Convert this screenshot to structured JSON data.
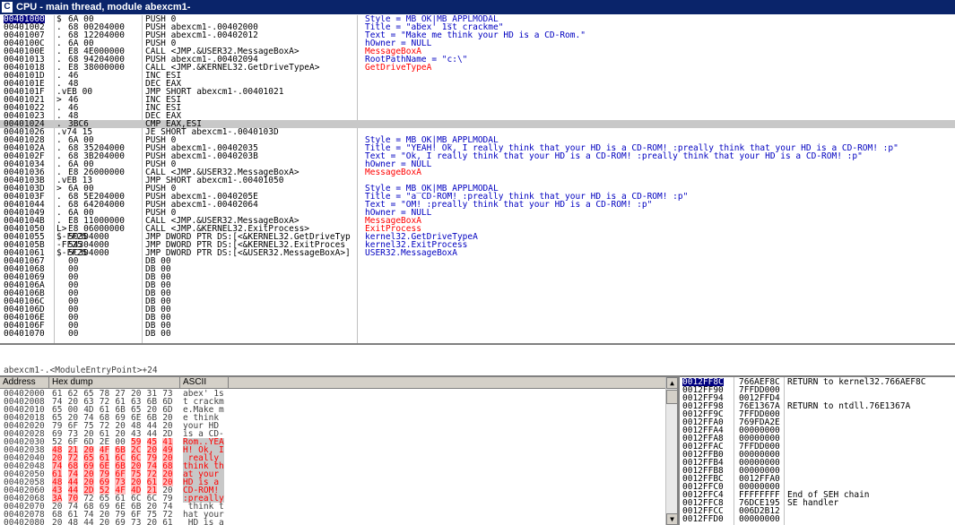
{
  "window": {
    "title": "CPU - main thread, module abexcm1-",
    "icon_glyph": "C"
  },
  "disasm": [
    {
      "addr": "00401000",
      "mark": "$",
      "hex": "6A 00",
      "asm": "PUSH 0",
      "cmt": "Style = MB_OK|MB_APPLMODAL",
      "sel": true
    },
    {
      "addr": "00401002",
      "mark": ".",
      "hex": "68 00204000",
      "asm": "PUSH abexcm1-.00402000",
      "cmt": "Title = \"abex' 1st crackme\""
    },
    {
      "addr": "00401007",
      "mark": ".",
      "hex": "68 12204000",
      "asm": "PUSH abexcm1-.00402012",
      "cmt": "Text = \"Make me think your HD is a CD-Rom.\""
    },
    {
      "addr": "0040100C",
      "mark": ".",
      "hex": "6A 00",
      "asm": "PUSH 0",
      "cmt": "hOwner = NULL"
    },
    {
      "addr": "0040100E",
      "mark": ".",
      "hex": "E8 4E000000",
      "asm": "CALL <JMP.&USER32.MessageBoxA>",
      "cmt": "MessageBoxA",
      "red": true
    },
    {
      "addr": "00401013",
      "mark": ".",
      "hex": "68 94204000",
      "asm": "PUSH abexcm1-.00402094",
      "cmt": "RootPathName = \"c:\\\""
    },
    {
      "addr": "00401018",
      "mark": ".",
      "hex": "E8 38000000",
      "asm": "CALL <JMP.&KERNEL32.GetDriveTypeA>",
      "cmt": "GetDriveTypeA",
      "red": true
    },
    {
      "addr": "0040101D",
      "mark": ".",
      "hex": "46",
      "asm": "INC ESI",
      "cmt": ""
    },
    {
      "addr": "0040101E",
      "mark": ".",
      "hex": "48",
      "asm": "DEC EAX",
      "cmt": ""
    },
    {
      "addr": "0040101F",
      "mark": ".vEB 00",
      "hex": "",
      "asm": "JMP SHORT abexcm1-.00401021",
      "cmt": ""
    },
    {
      "addr": "00401021",
      "mark": ">",
      "hex": "46",
      "asm": "INC ESI",
      "cmt": ""
    },
    {
      "addr": "00401022",
      "mark": ".",
      "hex": "46",
      "asm": "INC ESI",
      "cmt": ""
    },
    {
      "addr": "00401023",
      "mark": ".",
      "hex": "48",
      "asm": "DEC EAX",
      "cmt": ""
    },
    {
      "addr": "00401024",
      "mark": ".",
      "hex": "3BC6",
      "asm": "CMP EAX,ESI",
      "cmt": "",
      "eip": true
    },
    {
      "addr": "00401026",
      "mark": ".v74 15",
      "hex": "",
      "asm": "JE SHORT abexcm1-.0040103D",
      "cmt": ""
    },
    {
      "addr": "00401028",
      "mark": ".",
      "hex": "6A 00",
      "asm": "PUSH 0",
      "cmt": "Style = MB_OK|MB_APPLMODAL"
    },
    {
      "addr": "0040102A",
      "mark": ".",
      "hex": "68 35204000",
      "asm": "PUSH abexcm1-.00402035",
      "cmt": "Title = \"YEAH! Ok, I really think that your HD is a CD-ROM! :preally think that your HD is a CD-ROM! :p\""
    },
    {
      "addr": "0040102F",
      "mark": ".",
      "hex": "68 3B204000",
      "asm": "PUSH abexcm1-.0040203B",
      "cmt": "Text = \"Ok, I really think that your HD is a CD-ROM! :preally think that your HD is a CD-ROM! :p\""
    },
    {
      "addr": "00401034",
      "mark": ".",
      "hex": "6A 00",
      "asm": "PUSH 0",
      "cmt": "hOwner = NULL"
    },
    {
      "addr": "00401036",
      "mark": ".",
      "hex": "E8 26000000",
      "asm": "CALL <JMP.&USER32.MessageBoxA>",
      "cmt": "MessageBoxA",
      "red": true
    },
    {
      "addr": "0040103B",
      "mark": ".vEB 13",
      "hex": "",
      "asm": "JMP SHORT abexcm1-.00401050",
      "cmt": ""
    },
    {
      "addr": "0040103D",
      "mark": ">",
      "hex": "6A 00",
      "asm": "PUSH 0",
      "cmt": "Style = MB_OK|MB_APPLMODAL"
    },
    {
      "addr": "0040103F",
      "mark": ".",
      "hex": "68 5E204000",
      "asm": "PUSH abexcm1-.0040205E",
      "cmt": "Title = \"a CD-ROM! :preally think that your HD is a CD-ROM! :p\""
    },
    {
      "addr": "00401044",
      "mark": ".",
      "hex": "68 64204000",
      "asm": "PUSH abexcm1-.00402064",
      "cmt": "Text = \"OM! :preally think that your HD is a CD-ROM! :p\""
    },
    {
      "addr": "00401049",
      "mark": ".",
      "hex": "6A 00",
      "asm": "PUSH 0",
      "cmt": "hOwner = NULL"
    },
    {
      "addr": "0040104B",
      "mark": ".",
      "hex": "E8 11000000",
      "asm": "CALL <JMP.&USER32.MessageBoxA>",
      "cmt": "MessageBoxA",
      "red": true
    },
    {
      "addr": "00401050",
      "mark": "L>",
      "hex": "E8 06000000",
      "asm": "CALL <JMP.&KERNEL32.ExitProcess>",
      "cmt": "ExitProcess",
      "red": true
    },
    {
      "addr": "00401055",
      "mark": "$-FF25",
      "hex": "50304000",
      "asm": "JMP DWORD PTR DS:[<&KERNEL32.GetDriveTyp",
      "cmt": "kernel32.GetDriveTypeA"
    },
    {
      "addr": "0040105B",
      "mark": "-FF25",
      "hex": "54304000",
      "asm": "JMP DWORD PTR DS:[<&KERNEL32.ExitProces",
      "cmt": "kernel32.ExitProcess"
    },
    {
      "addr": "00401061",
      "mark": "$-FF25",
      "hex": "5C304000",
      "asm": "JMP DWORD PTR DS:[<&USER32.MessageBoxA>]",
      "cmt": "USER32.MessageBoxA"
    },
    {
      "addr": "00401067",
      "mark": "",
      "hex": "00",
      "asm": "DB 00",
      "cmt": ""
    },
    {
      "addr": "00401068",
      "mark": "",
      "hex": "00",
      "asm": "DB 00",
      "cmt": ""
    },
    {
      "addr": "00401069",
      "mark": "",
      "hex": "00",
      "asm": "DB 00",
      "cmt": ""
    },
    {
      "addr": "0040106A",
      "mark": "",
      "hex": "00",
      "asm": "DB 00",
      "cmt": ""
    },
    {
      "addr": "0040106B",
      "mark": "",
      "hex": "00",
      "asm": "DB 00",
      "cmt": ""
    },
    {
      "addr": "0040106C",
      "mark": "",
      "hex": "00",
      "asm": "DB 00",
      "cmt": ""
    },
    {
      "addr": "0040106D",
      "mark": "",
      "hex": "00",
      "asm": "DB 00",
      "cmt": ""
    },
    {
      "addr": "0040106E",
      "mark": "",
      "hex": "00",
      "asm": "DB 00",
      "cmt": ""
    },
    {
      "addr": "0040106F",
      "mark": "",
      "hex": "00",
      "asm": "DB 00",
      "cmt": ""
    },
    {
      "addr": "00401070",
      "mark": "",
      "hex": "00",
      "asm": "DB 00",
      "cmt": ""
    }
  ],
  "info_line": "abexcm1-.<ModuleEntryPoint>+24",
  "dump": {
    "headers": {
      "address": "Address",
      "hex": "Hex dump",
      "ascii": "ASCII"
    },
    "rows": [
      {
        "addr": "00402000",
        "bytes": [
          "61",
          "62",
          "65",
          "78",
          "27",
          "20",
          "31",
          "73"
        ],
        "ascii": "abex' 1s",
        "hl": []
      },
      {
        "addr": "00402008",
        "bytes": [
          "74",
          "20",
          "63",
          "72",
          "61",
          "63",
          "6B",
          "6D"
        ],
        "ascii": "t crackm",
        "hl": []
      },
      {
        "addr": "00402010",
        "bytes": [
          "65",
          "00",
          "4D",
          "61",
          "6B",
          "65",
          "20",
          "6D"
        ],
        "ascii": "e.Make m",
        "hl": []
      },
      {
        "addr": "00402018",
        "bytes": [
          "65",
          "20",
          "74",
          "68",
          "69",
          "6E",
          "6B",
          "20"
        ],
        "ascii": "e think ",
        "hl": []
      },
      {
        "addr": "00402020",
        "bytes": [
          "79",
          "6F",
          "75",
          "72",
          "20",
          "48",
          "44",
          "20"
        ],
        "ascii": "your HD ",
        "hl": []
      },
      {
        "addr": "00402028",
        "bytes": [
          "69",
          "73",
          "20",
          "61",
          "20",
          "43",
          "44",
          "2D"
        ],
        "ascii": "is a CD-",
        "hl": []
      },
      {
        "addr": "00402030",
        "bytes": [
          "52",
          "6F",
          "6D",
          "2E",
          "00",
          "59",
          "45",
          "41"
        ],
        "ascii": "Rom..YEA",
        "hl": [
          5,
          6,
          7
        ]
      },
      {
        "addr": "00402038",
        "bytes": [
          "48",
          "21",
          "20",
          "4F",
          "6B",
          "2C",
          "20",
          "49"
        ],
        "ascii": "H! Ok, I",
        "hl": [
          0,
          1,
          2,
          3,
          4,
          5,
          6,
          7
        ]
      },
      {
        "addr": "00402040",
        "bytes": [
          "20",
          "72",
          "65",
          "61",
          "6C",
          "6C",
          "79",
          "20"
        ],
        "ascii": " really ",
        "hl": [
          0,
          1,
          2,
          3,
          4,
          5,
          6,
          7
        ]
      },
      {
        "addr": "00402048",
        "bytes": [
          "74",
          "68",
          "69",
          "6E",
          "6B",
          "20",
          "74",
          "68"
        ],
        "ascii": "think th",
        "hl": [
          0,
          1,
          2,
          3,
          4,
          5,
          6,
          7
        ]
      },
      {
        "addr": "00402050",
        "bytes": [
          "61",
          "74",
          "20",
          "79",
          "6F",
          "75",
          "72",
          "20"
        ],
        "ascii": "at your ",
        "hl": [
          0,
          1,
          2,
          3,
          4,
          5,
          6,
          7
        ]
      },
      {
        "addr": "00402058",
        "bytes": [
          "48",
          "44",
          "20",
          "69",
          "73",
          "20",
          "61",
          "20"
        ],
        "ascii": "HD is a ",
        "hl": [
          0,
          1,
          2,
          3,
          4,
          5,
          6,
          7
        ]
      },
      {
        "addr": "00402060",
        "bytes": [
          "43",
          "44",
          "2D",
          "52",
          "4F",
          "4D",
          "21",
          "20"
        ],
        "ascii": "CD-ROM! ",
        "hl": [
          0,
          1,
          2,
          3,
          4,
          5,
          6
        ]
      },
      {
        "addr": "00402068",
        "bytes": [
          "3A",
          "70",
          "72",
          "65",
          "61",
          "6C",
          "6C",
          "79"
        ],
        "ascii": ":preally",
        "hl": [
          0,
          1
        ]
      },
      {
        "addr": "00402070",
        "bytes": [
          "20",
          "74",
          "68",
          "69",
          "6E",
          "6B",
          "20",
          "74"
        ],
        "ascii": " think t",
        "hl": []
      },
      {
        "addr": "00402078",
        "bytes": [
          "68",
          "61",
          "74",
          "20",
          "79",
          "6F",
          "75",
          "72"
        ],
        "ascii": "hat your",
        "hl": []
      },
      {
        "addr": "00402080",
        "bytes": [
          "20",
          "48",
          "44",
          "20",
          "69",
          "73",
          "20",
          "61"
        ],
        "ascii": " HD is a",
        "hl": []
      }
    ]
  },
  "stack": [
    {
      "addr": "0012FF8C",
      "val": "766AEF8C",
      "cmt": "RETURN to kernel32.766AEF8C",
      "sel": true
    },
    {
      "addr": "0012FF90",
      "val": "7FFDD000",
      "cmt": ""
    },
    {
      "addr": "0012FF94",
      "val": "0012FFD4",
      "cmt": ""
    },
    {
      "addr": "0012FF98",
      "val": "76E1367A",
      "cmt": "RETURN to ntdll.76E1367A"
    },
    {
      "addr": "0012FF9C",
      "val": "7FFDD000",
      "cmt": ""
    },
    {
      "addr": "0012FFA0",
      "val": "769FDA2E",
      "cmt": ""
    },
    {
      "addr": "0012FFA4",
      "val": "00000000",
      "cmt": ""
    },
    {
      "addr": "0012FFA8",
      "val": "00000000",
      "cmt": ""
    },
    {
      "addr": "0012FFAC",
      "val": "7FFDD000",
      "cmt": ""
    },
    {
      "addr": "0012FFB0",
      "val": "00000000",
      "cmt": ""
    },
    {
      "addr": "0012FFB4",
      "val": "00000000",
      "cmt": ""
    },
    {
      "addr": "0012FFB8",
      "val": "00000000",
      "cmt": ""
    },
    {
      "addr": "0012FFBC",
      "val": "0012FFA0",
      "cmt": ""
    },
    {
      "addr": "0012FFC0",
      "val": "00000000",
      "cmt": ""
    },
    {
      "addr": "0012FFC4",
      "val": "FFFFFFFF",
      "cmt": "End of SEH chain"
    },
    {
      "addr": "0012FFC8",
      "val": "76DCE195",
      "cmt": "SE handler"
    },
    {
      "addr": "0012FFCC",
      "val": "006D2B12",
      "cmt": ""
    },
    {
      "addr": "0012FFD0",
      "val": "00000000",
      "cmt": ""
    }
  ],
  "colors": {
    "title_bg": "#0a246a",
    "selection": "#000080",
    "comment_red": "#ff0000",
    "dump_highlight": "#ffc0c0"
  }
}
